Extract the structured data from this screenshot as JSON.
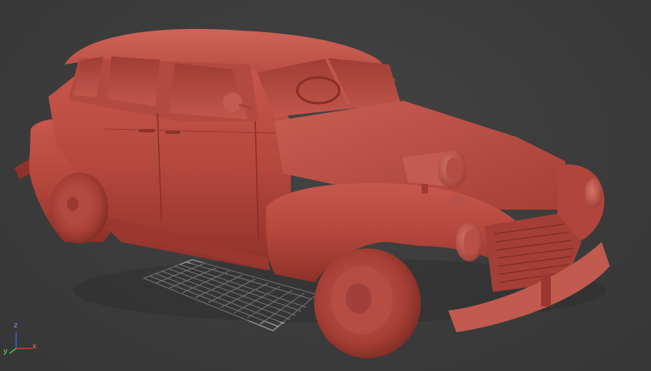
{
  "viewport": {
    "background": "#3d3d3d",
    "object_color": "#b84a40",
    "grid_color": "#b8b8b8"
  },
  "axis_gizmo": {
    "x_label": "x",
    "y_label": "y",
    "z_label": "z",
    "x_color": "#d83a2e",
    "y_color": "#3bc43b",
    "z_color": "#3a5ad8"
  }
}
